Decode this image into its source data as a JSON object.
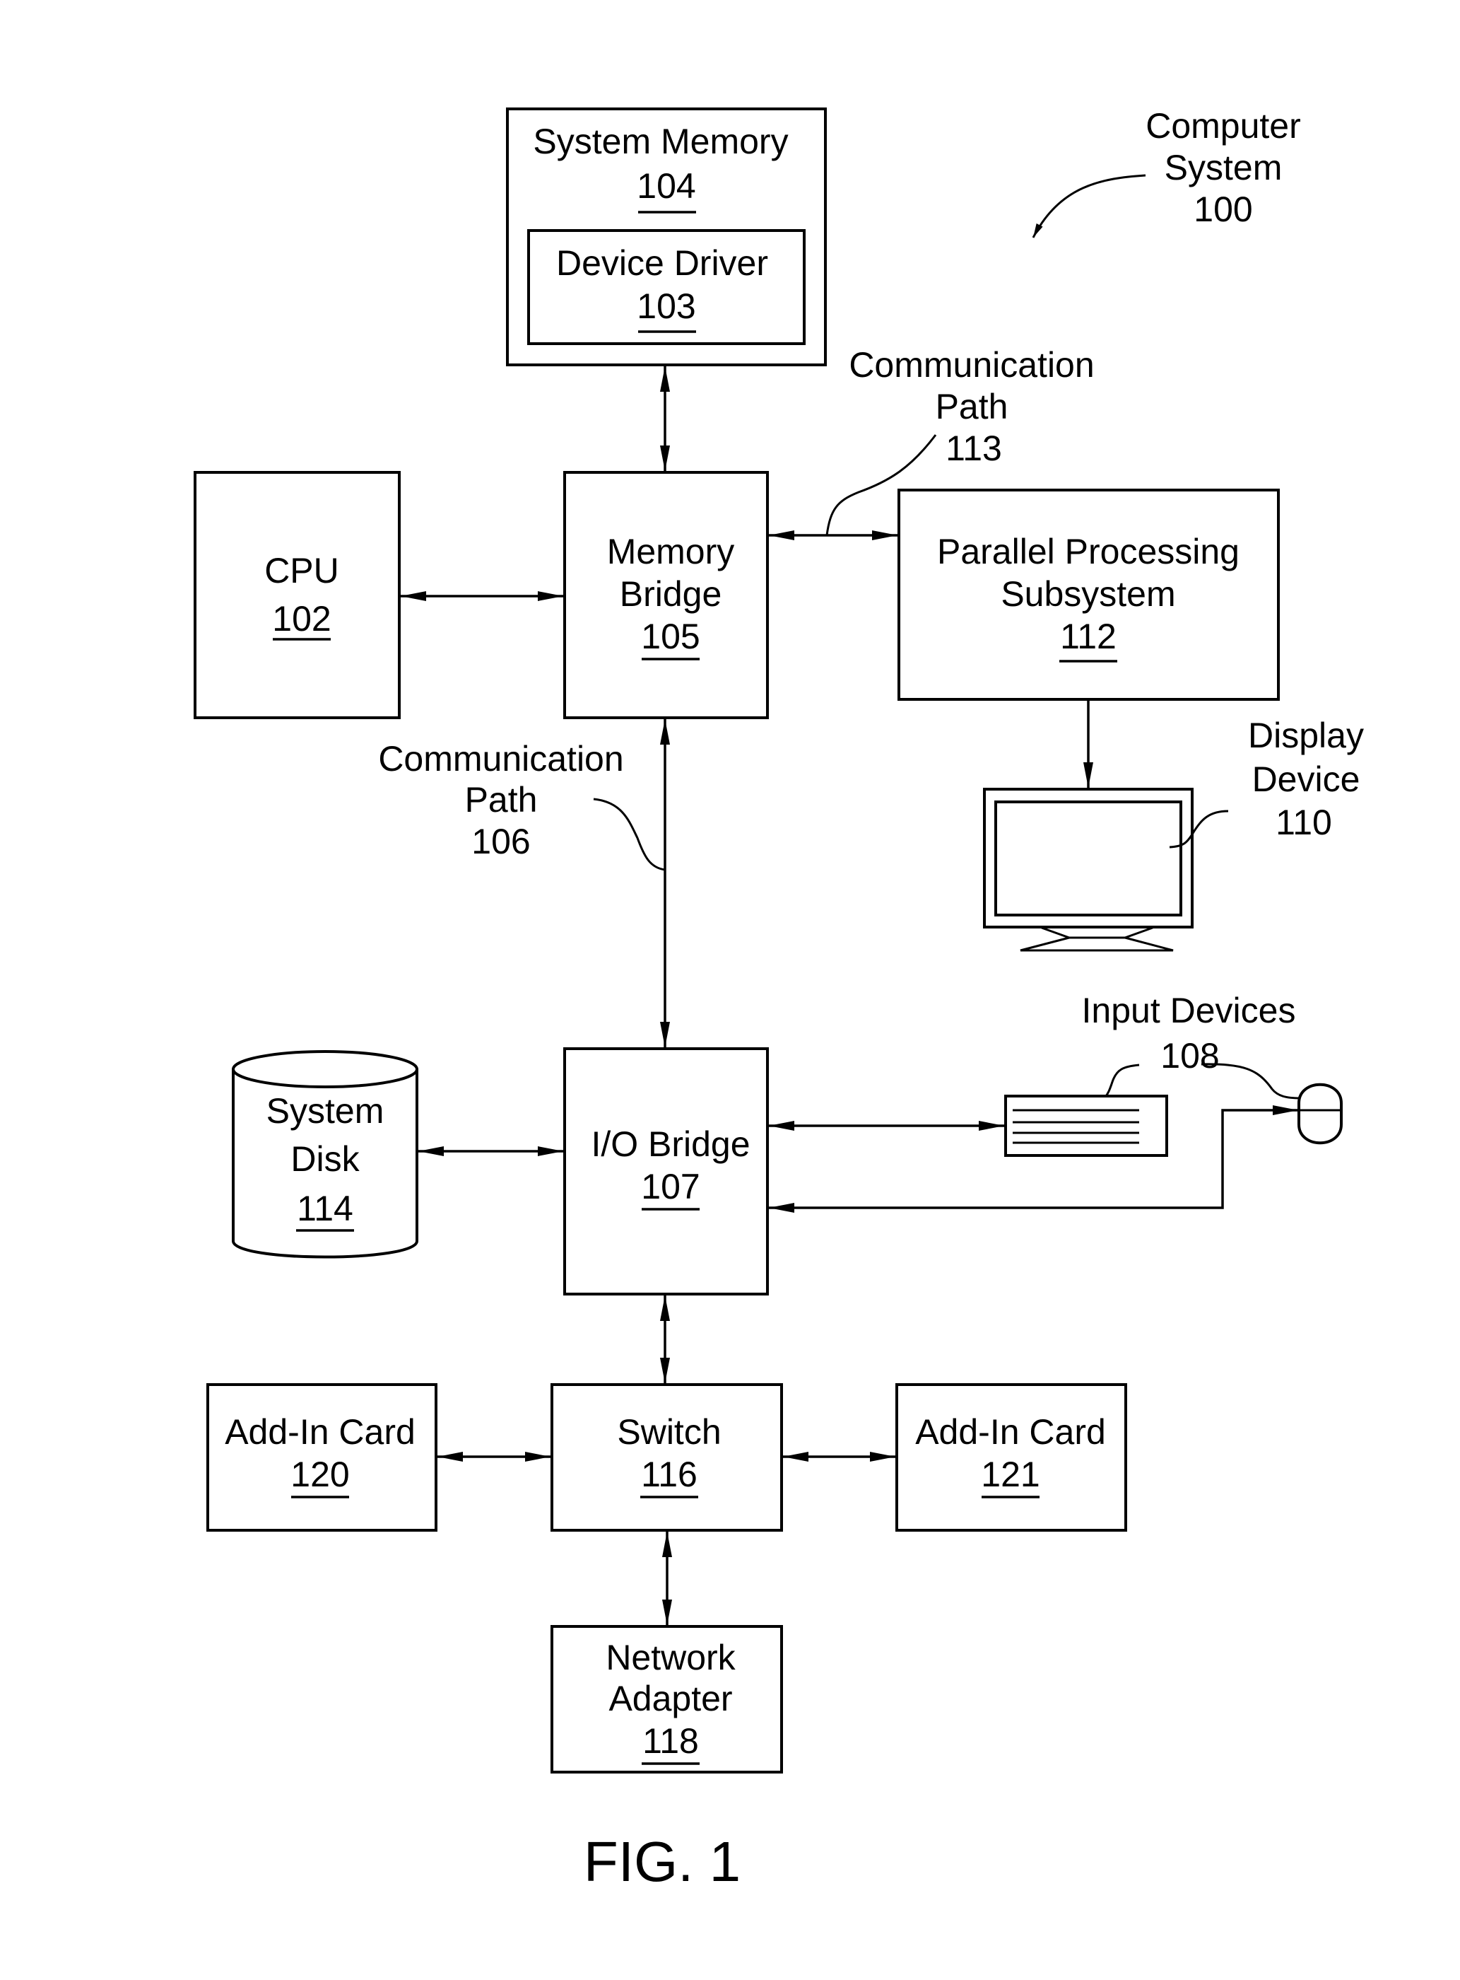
{
  "figure": {
    "title": "FIG. 1",
    "system_label": [
      "Computer",
      "System",
      "100"
    ]
  },
  "components": {
    "system_memory": {
      "lines": [
        "System Memory"
      ],
      "ref": "104"
    },
    "device_driver": {
      "lines": [
        "Device Driver"
      ],
      "ref": "103"
    },
    "cpu": {
      "lines": [
        "CPU"
      ],
      "ref": "102"
    },
    "memory_bridge": {
      "lines": [
        "Memory",
        "Bridge"
      ],
      "ref": "105"
    },
    "parallel_processing_subsystem": {
      "lines": [
        "Parallel Processing",
        "Subsystem"
      ],
      "ref": "112"
    },
    "io_bridge": {
      "lines": [
        "I/O Bridge"
      ],
      "ref": "107"
    },
    "system_disk": {
      "lines": [
        "System",
        "Disk"
      ],
      "ref": "114"
    },
    "switch": {
      "lines": [
        "Switch"
      ],
      "ref": "116"
    },
    "add_in_card_120": {
      "lines": [
        "Add-In Card"
      ],
      "ref": "120"
    },
    "add_in_card_121": {
      "lines": [
        "Add-In Card"
      ],
      "ref": "121"
    },
    "network_adapter": {
      "lines": [
        "Network",
        "Adapter"
      ],
      "ref": "118"
    }
  },
  "callouts": {
    "communication_path_113": [
      "Communication",
      "Path",
      "113"
    ],
    "communication_path_106": [
      "Communication",
      "Path",
      "106"
    ],
    "display_device": [
      "Display",
      "Device",
      "110"
    ],
    "input_devices": [
      "Input Devices",
      "108"
    ]
  },
  "connections": [
    {
      "from": "system_memory",
      "to": "memory_bridge",
      "direction": "bidirectional"
    },
    {
      "from": "cpu",
      "to": "memory_bridge",
      "direction": "bidirectional"
    },
    {
      "from": "memory_bridge",
      "to": "parallel_processing_subsystem",
      "direction": "bidirectional",
      "label": "Communication Path 113"
    },
    {
      "from": "parallel_processing_subsystem",
      "to": "display_device",
      "direction": "forward"
    },
    {
      "from": "memory_bridge",
      "to": "io_bridge",
      "direction": "bidirectional",
      "label": "Communication Path 106"
    },
    {
      "from": "system_disk",
      "to": "io_bridge",
      "direction": "bidirectional"
    },
    {
      "from": "io_bridge",
      "to": "keyboard",
      "direction": "bidirectional"
    },
    {
      "from": "mouse",
      "to": "io_bridge",
      "direction": "forward"
    },
    {
      "from": "io_bridge",
      "to": "switch",
      "direction": "bidirectional"
    },
    {
      "from": "add_in_card_120",
      "to": "switch",
      "direction": "bidirectional"
    },
    {
      "from": "switch",
      "to": "add_in_card_121",
      "direction": "bidirectional"
    },
    {
      "from": "switch",
      "to": "network_adapter",
      "direction": "bidirectional"
    }
  ]
}
